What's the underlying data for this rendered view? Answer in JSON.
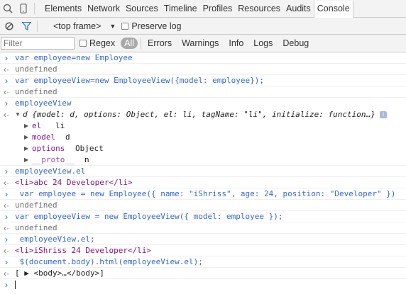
{
  "tabs": [
    {
      "label": "Elements"
    },
    {
      "label": "Network"
    },
    {
      "label": "Sources"
    },
    {
      "label": "Timeline"
    },
    {
      "label": "Profiles"
    },
    {
      "label": "Resources"
    },
    {
      "label": "Audits"
    },
    {
      "label": "Console"
    }
  ],
  "toolbar": {
    "frame_label": "<top frame>",
    "preserve_log_label": "Preserve log"
  },
  "filterbar": {
    "filter_placeholder": "Filter",
    "regex_label": "Regex",
    "levels": [
      "All",
      "Errors",
      "Warnings",
      "Info",
      "Logs",
      "Debug"
    ]
  },
  "console": {
    "lines": [
      {
        "kind": "input",
        "text": "var employee=new Employee"
      },
      {
        "kind": "result",
        "text": "undefined"
      },
      {
        "kind": "input",
        "text": "var employeeView=new EmployeeView({model: employee});"
      },
      {
        "kind": "result",
        "text": "undefined"
      },
      {
        "kind": "input",
        "text": "employeeView"
      },
      {
        "kind": "object",
        "text": "d {model: d, options: Object, el: li, tagName: \"li\", initialize: function…}"
      },
      {
        "kind": "prop",
        "key": "el",
        "value": "li"
      },
      {
        "kind": "prop",
        "key": "model",
        "value": "d"
      },
      {
        "kind": "prop",
        "key": "options",
        "value": "Object"
      },
      {
        "kind": "prop",
        "key": "__proto__",
        "value": "n"
      },
      {
        "kind": "input",
        "text": "employeeView.el"
      },
      {
        "kind": "html",
        "text": "<li>abc 24 Developer</li>"
      },
      {
        "kind": "input",
        "text": " var employee = new Employee({ name: \"iShriss\", age: 24, position: \"Developer\" })"
      },
      {
        "kind": "result",
        "text": "undefined"
      },
      {
        "kind": "input",
        "text": "var employeeView = new EmployeeView({ model: employee });"
      },
      {
        "kind": "result",
        "text": "undefined"
      },
      {
        "kind": "input",
        "text": " employeeView.el;"
      },
      {
        "kind": "html",
        "text": "<li>iShriss 24 Developer</li>"
      },
      {
        "kind": "input",
        "text": " $(document.body).html(employeeView.el);"
      },
      {
        "kind": "array",
        "text": "[ ▶ <body>…</body>]"
      },
      {
        "kind": "prompt",
        "text": ""
      }
    ]
  }
}
